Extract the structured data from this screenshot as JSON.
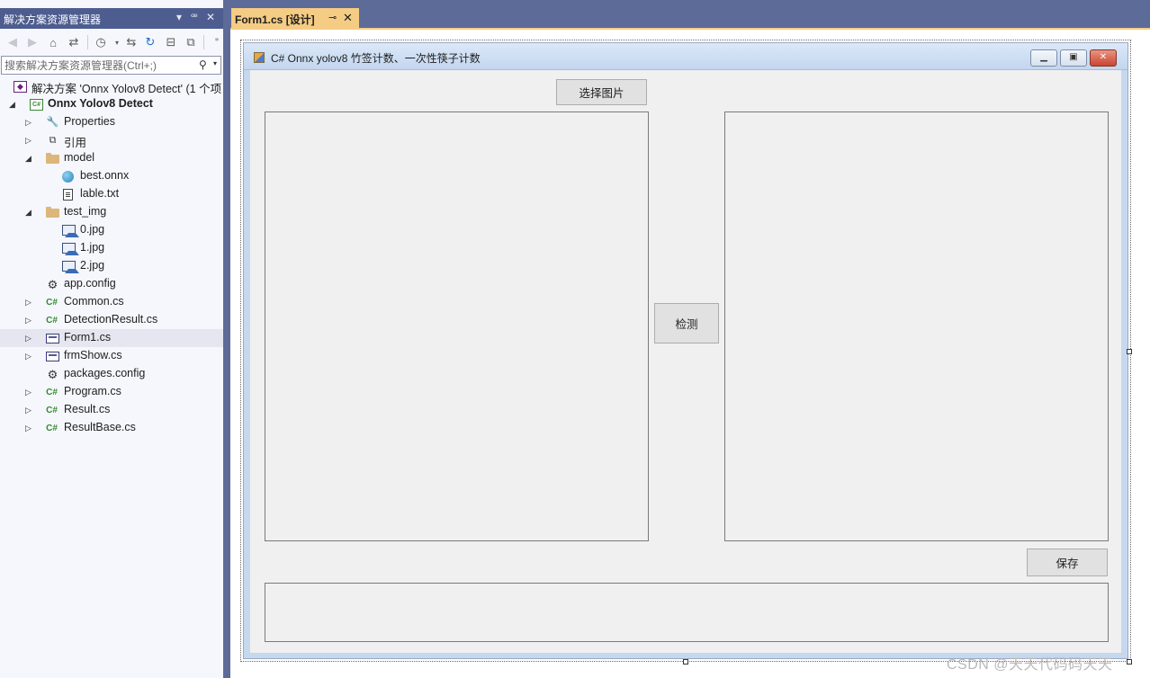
{
  "solution_explorer": {
    "title": "解决方案资源管理器",
    "search_placeholder": "搜索解决方案资源管理器(Ctrl+;)",
    "solution_label": "解决方案 'Onnx Yolov8 Detect' (1 个项",
    "project_label": "Onnx Yolov8 Detect",
    "items": [
      {
        "label": "Properties"
      },
      {
        "label": "引用"
      },
      {
        "label": "model"
      },
      {
        "label": "best.onnx"
      },
      {
        "label": "lable.txt"
      },
      {
        "label": "test_img"
      },
      {
        "label": "0.jpg"
      },
      {
        "label": "1.jpg"
      },
      {
        "label": "2.jpg"
      },
      {
        "label": "app.config"
      },
      {
        "label": "Common.cs"
      },
      {
        "label": "DetectionResult.cs"
      },
      {
        "label": "Form1.cs"
      },
      {
        "label": "frmShow.cs"
      },
      {
        "label": "packages.config"
      },
      {
        "label": "Program.cs"
      },
      {
        "label": "Result.cs"
      },
      {
        "label": "ResultBase.cs"
      }
    ]
  },
  "document_tab": {
    "label": "Form1.cs [设计]"
  },
  "form": {
    "title": "C# Onnx yolov8 竹签计数、一次性筷子计数",
    "select_image_button": "选择图片",
    "detect_button": "检测",
    "save_button": "保存"
  },
  "watermark": "CSDN @天天代码码天天",
  "colors": {
    "vs_chrome": "#5d6b99",
    "active_tab": "#f5cc84",
    "form_bg": "#f0f0f0",
    "csharp_green": "#368832"
  }
}
